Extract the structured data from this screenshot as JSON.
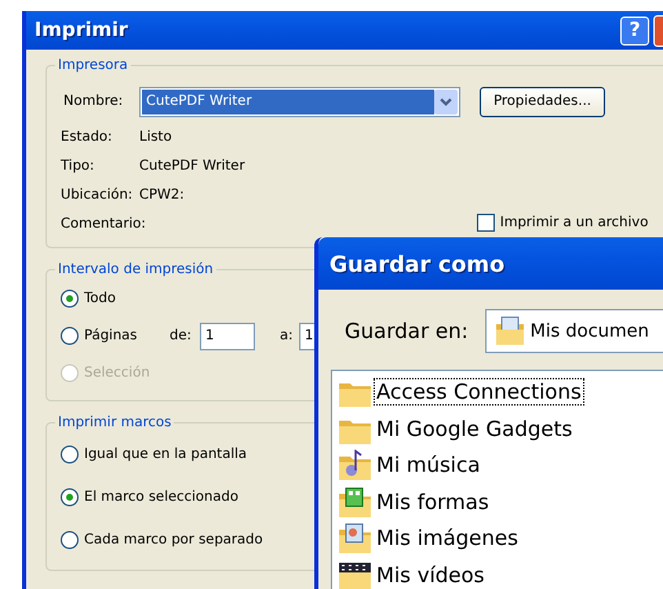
{
  "print_dialog": {
    "title": "Imprimir",
    "help_button": "?",
    "printer": {
      "legend": "Impresora",
      "name_label": "Nombre:",
      "name_value": "CutePDF Writer",
      "properties_button": "Propiedades...",
      "info": [
        {
          "label": "Estado:",
          "value": "Listo"
        },
        {
          "label": "Tipo:",
          "value": "CutePDF Writer"
        },
        {
          "label": "Ubicación:",
          "value": "CPW2:"
        },
        {
          "label": "Comentario:"
        }
      ],
      "print_to_file": {
        "label": "Imprimir a un archivo",
        "checked": false
      }
    },
    "range": {
      "legend": "Intervalo de impresión",
      "options": [
        {
          "label": "Todo",
          "selected": true,
          "disabled": false
        },
        {
          "label": "Páginas",
          "selected": false,
          "disabled": false
        },
        {
          "label": "Selección",
          "selected": false,
          "disabled": true
        }
      ],
      "from_label": "de:",
      "from_value": "1",
      "to_label": "a:",
      "to_value": "1"
    },
    "frames": {
      "legend": "Imprimir marcos",
      "options": [
        {
          "label": "Igual que en la pantalla",
          "selected": false
        },
        {
          "label": "El marco seleccionado",
          "selected": true
        },
        {
          "label": "Cada marco por separado",
          "selected": false
        }
      ]
    }
  },
  "save_dialog": {
    "title": "Guardar como",
    "location_label": "Guardar en:",
    "location_value": "Mis documen",
    "items": [
      {
        "kind": "folder",
        "label": "Access Connections",
        "focused": true
      },
      {
        "kind": "folder",
        "label": "Mi Google Gadgets",
        "focused": false
      },
      {
        "kind": "music",
        "label": "Mi música",
        "focused": false
      },
      {
        "kind": "forms",
        "label": "Mis formas",
        "focused": false
      },
      {
        "kind": "images",
        "label": "Mis imágenes",
        "focused": false
      },
      {
        "kind": "videos",
        "label": "Mis vídeos",
        "focused": false
      }
    ]
  }
}
